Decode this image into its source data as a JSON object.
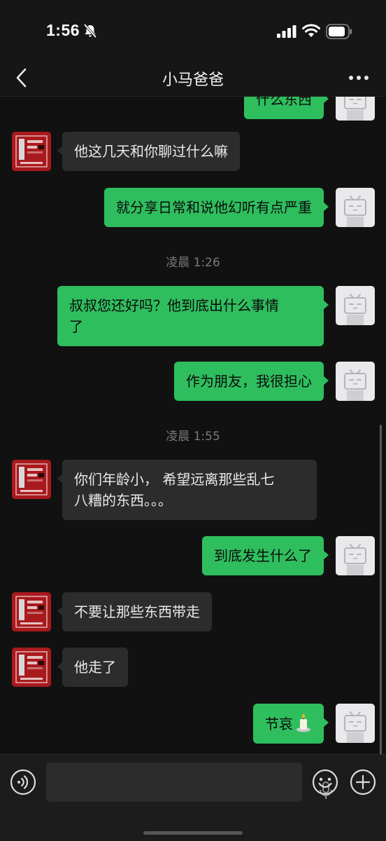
{
  "status_bar": {
    "time": "1:56"
  },
  "nav": {
    "title": "小马爸爸"
  },
  "messages": [
    {
      "side": "right",
      "text": "什么东西"
    },
    {
      "side": "left",
      "text": "他这几天和你聊过什么嘛"
    },
    {
      "side": "right",
      "text": "就分享日常和说他幻听有点严重"
    },
    {
      "side": "time",
      "text": "凌晨 1:26"
    },
    {
      "side": "right",
      "text": "叔叔您还好吗？他到底出什么事情\n了"
    },
    {
      "side": "right",
      "text": "作为朋友，我很担心"
    },
    {
      "side": "time",
      "text": "凌晨 1:55"
    },
    {
      "side": "left",
      "text": "你们年龄小， 希望远离那些乱七\n八糟的东西。。。"
    },
    {
      "side": "right",
      "text": "到底发生什么了"
    },
    {
      "side": "left",
      "text": "不要让那些东西带走"
    },
    {
      "side": "left",
      "text": "他走了"
    },
    {
      "side": "right",
      "text": "节哀"
    }
  ],
  "icons": {
    "silent": "bell-slash-icon",
    "back": "chevron-left-icon",
    "more": "ellipsis-icon",
    "voice": "voice-icon",
    "mic": "microphone-icon",
    "emoji": "emoji-icon",
    "plus": "plus-icon",
    "candle": "candle-emoji"
  },
  "colors": {
    "outgoing_bubble": "#2fbe5e",
    "incoming_bubble": "#2c2c2c",
    "background": "#111111"
  }
}
